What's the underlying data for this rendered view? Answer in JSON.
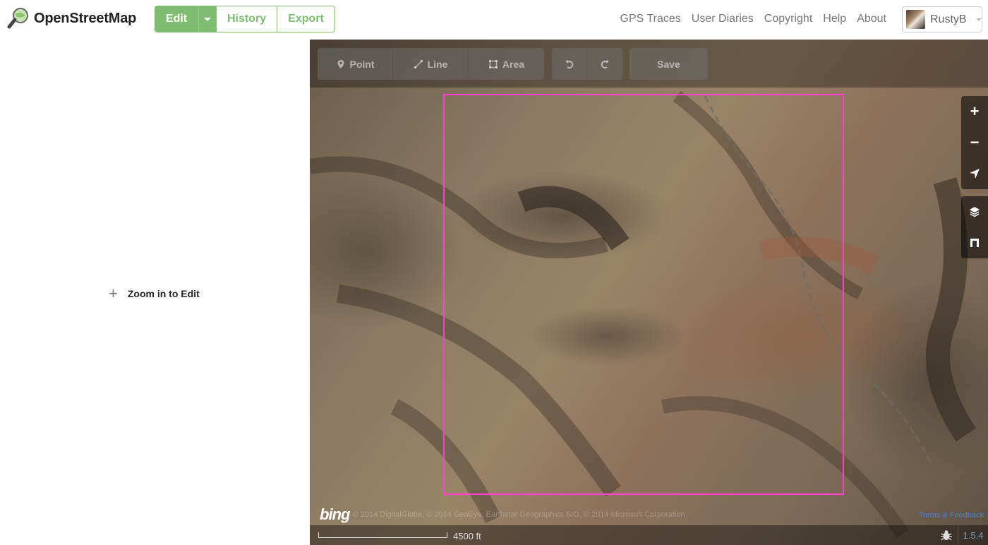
{
  "header": {
    "logo_text": "OpenStreetMap",
    "tabs": {
      "edit": "Edit",
      "history": "History",
      "export": "Export"
    },
    "nav": [
      "GPS Traces",
      "User Diaries",
      "Copyright",
      "Help",
      "About"
    ],
    "user": {
      "name": "RustyB"
    }
  },
  "sidebar": {
    "zoom_to_edit": "Zoom in to Edit"
  },
  "toolbar": {
    "point": "Point",
    "line": "Line",
    "area": "Area",
    "save": "Save"
  },
  "map": {
    "attribution_logo": "bing",
    "attribution": "© 2014 DigitalGlobe, © 2014 GeoEye, Earthstar Geographics SIO, © 2014 Microsoft Corporation",
    "terms": "Terms & Feedback",
    "scale": "4500 ft",
    "version": "1.5.4",
    "bbox_color": "#ff3fd0"
  },
  "colors": {
    "accent": "#7ebc6f"
  },
  "icons": [
    "osm-logo-icon",
    "caret-down-icon",
    "point-icon",
    "line-icon",
    "area-icon",
    "undo-icon",
    "redo-icon",
    "zoom-in-icon",
    "zoom-out-icon",
    "locate-icon",
    "layers-icon",
    "map-data-icon",
    "bug-icon"
  ]
}
